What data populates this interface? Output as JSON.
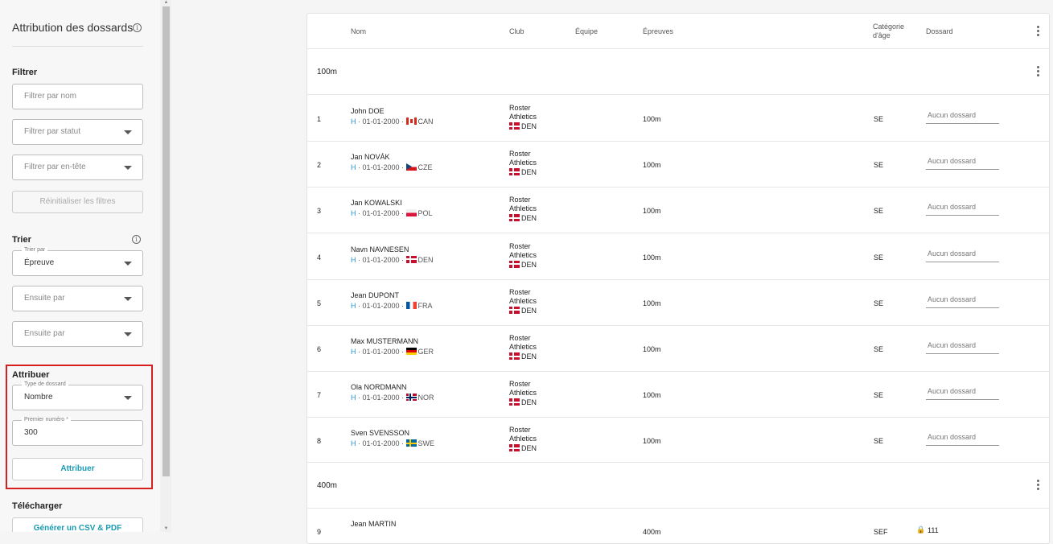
{
  "sidebar": {
    "title": "Attribution des dossards",
    "filter": {
      "label": "Filtrer",
      "name_placeholder": "Filtrer par nom",
      "status_placeholder": "Filtrer par statut",
      "header_placeholder": "Filtrer par en-tête",
      "reset_label": "Réinitialiser les filtres"
    },
    "sort": {
      "label": "Trier",
      "sort_by_floatlabel": "Trier par",
      "sort_by_value": "Épreuve",
      "then_by_1": "Ensuite par",
      "then_by_2": "Ensuite par"
    },
    "assign": {
      "label": "Attribuer",
      "type_floatlabel": "Type de dossard",
      "type_value": "Nombre",
      "first_number_floatlabel": "Premier numéro *",
      "first_number_value": "300",
      "button_label": "Attribuer"
    },
    "download": {
      "label": "Télécharger",
      "button_label": "Générer un CSV & PDF"
    }
  },
  "table": {
    "headers": {
      "name": "Nom",
      "club": "Club",
      "team": "Équipe",
      "events": "Épreuves",
      "age_cat_line1": "Catégorie",
      "age_cat_line2": "d'âge",
      "bib": "Dossard"
    },
    "groups": [
      {
        "label": "100m",
        "rows": [
          {
            "num": "1",
            "name": "John DOE",
            "sex": "H",
            "dob": " · 01-01-2000 · ",
            "flag": "can",
            "country": "CAN",
            "club_line1": "Roster",
            "club_line2": "Athletics",
            "club_country": "DEN",
            "event": "100m",
            "cat": "SE",
            "bib_placeholder": "Aucun dossard"
          },
          {
            "num": "2",
            "name": "Jan NOVÁK",
            "sex": "H",
            "dob": " · 01-01-2000 · ",
            "flag": "cze",
            "country": "CZE",
            "club_line1": "Roster",
            "club_line2": "Athletics",
            "club_country": "DEN",
            "event": "100m",
            "cat": "SE",
            "bib_placeholder": "Aucun dossard"
          },
          {
            "num": "3",
            "name": "Jan KOWALSKI",
            "sex": "H",
            "dob": " · 01-01-2000 · ",
            "flag": "pol",
            "country": "POL",
            "club_line1": "Roster",
            "club_line2": "Athletics",
            "club_country": "DEN",
            "event": "100m",
            "cat": "SE",
            "bib_placeholder": "Aucun dossard"
          },
          {
            "num": "4",
            "name": "Navn NAVNESEN",
            "sex": "H",
            "dob": " · 01-01-2000 · ",
            "flag": "den",
            "country": "DEN",
            "club_line1": "Roster",
            "club_line2": "Athletics",
            "club_country": "DEN",
            "event": "100m",
            "cat": "SE",
            "bib_placeholder": "Aucun dossard"
          },
          {
            "num": "5",
            "name": "Jean DUPONT",
            "sex": "H",
            "dob": " · 01-01-2000 · ",
            "flag": "fra",
            "country": "FRA",
            "club_line1": "Roster",
            "club_line2": "Athletics",
            "club_country": "DEN",
            "event": "100m",
            "cat": "SE",
            "bib_placeholder": "Aucun dossard"
          },
          {
            "num": "6",
            "name": "Max MUSTERMANN",
            "sex": "H",
            "dob": " · 01-01-2000 · ",
            "flag": "ger",
            "country": "GER",
            "club_line1": "Roster",
            "club_line2": "Athletics",
            "club_country": "DEN",
            "event": "100m",
            "cat": "SE",
            "bib_placeholder": "Aucun dossard"
          },
          {
            "num": "7",
            "name": "Ola NORDMANN",
            "sex": "H",
            "dob": " · 01-01-2000 · ",
            "flag": "nor",
            "country": "NOR",
            "club_line1": "Roster",
            "club_line2": "Athletics",
            "club_country": "DEN",
            "event": "100m",
            "cat": "SE",
            "bib_placeholder": "Aucun dossard"
          },
          {
            "num": "8",
            "name": "Sven SVENSSON",
            "sex": "H",
            "dob": " · 01-01-2000 · ",
            "flag": "swe",
            "country": "SWE",
            "club_line1": "Roster",
            "club_line2": "Athletics",
            "club_country": "DEN",
            "event": "100m",
            "cat": "SE",
            "bib_placeholder": "Aucun dossard"
          }
        ]
      },
      {
        "label": "400m",
        "rows": [
          {
            "num": "9",
            "name": "Jean MARTIN",
            "event": "400m",
            "cat": "SEF",
            "bib_value": "111"
          }
        ]
      }
    ]
  },
  "colors": {
    "accent": "#1a9ab0",
    "highlight": "#d62020",
    "sex_link": "#2a8fc9"
  }
}
